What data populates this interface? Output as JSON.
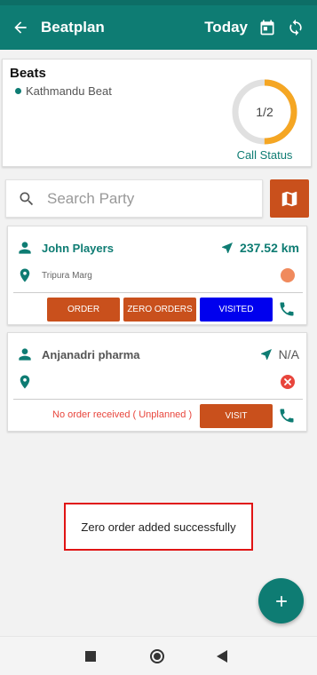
{
  "app_bar": {
    "title": "Beatplan",
    "date_label": "Today"
  },
  "beats": {
    "heading": "Beats",
    "beat_name": "Kathmandu Beat",
    "call_status_value": "1/2",
    "call_status_fraction": 0.5,
    "call_status_label": "Call Status"
  },
  "search": {
    "placeholder": "Search Party",
    "value": ""
  },
  "parties": [
    {
      "name": "John Players",
      "distance": "237.52 km",
      "address": "Tripura Marg",
      "buttons": {
        "order": "ORDER",
        "zero_orders": "ZERO ORDERS",
        "visited": "VISITED"
      }
    },
    {
      "name": "Anjanadri pharma",
      "distance": "N/A",
      "status_text": "No order received ( Unplanned )",
      "buttons": {
        "visit": "VISIT"
      }
    }
  ],
  "toast": {
    "message": "Zero order added successfully"
  },
  "colors": {
    "primary": "#0e7c73",
    "accent": "#c9501c",
    "visited": "#0000ee",
    "ring_track": "#e0e0e0",
    "ring_progress": "#f5a623",
    "status_orange": "#f08a5d",
    "status_red": "#e8453c",
    "toast_border": "#e01414"
  },
  "icons": {
    "back": "arrow-left-icon",
    "calendar": "calendar-icon",
    "refresh": "sync-icon",
    "search": "search-icon",
    "map": "map-icon",
    "person": "person-icon",
    "location": "location-pin-icon",
    "navigation": "navigation-arrow-icon",
    "phone": "phone-icon",
    "add": "plus-icon"
  }
}
